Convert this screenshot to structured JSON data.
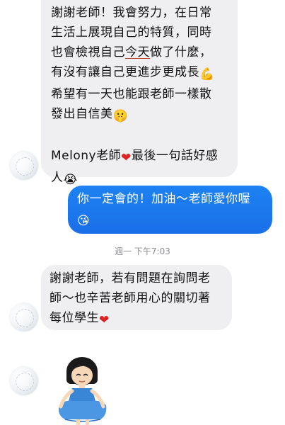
{
  "thread": {
    "bubble_1": {
      "lines": [
        "謝謝老師！我會努力，在日常",
        "生活上展現自己的特質，同時",
        "也會檢視自己",
        "今天",
        "做了什麼，",
        "有沒有讓自己更進步更成長",
        "希望有一天也能跟老師一樣散",
        "發出自信美",
        "Melony老師",
        "最後一句話好感",
        "人"
      ],
      "emojis": {
        "muscle": "💪",
        "shush": "🤫",
        "heart": "❤",
        "cry": "😭"
      }
    },
    "bubble_2": {
      "line_1": "你一定會的！加油～老師愛你喔",
      "emoji": "😘"
    },
    "timestamp": "週一 下午7:03",
    "bubble_3": {
      "lines": [
        "謝謝老師，若有問題在詢問老",
        "師～也辛苦老師用心的關切著",
        "每位學生"
      ],
      "heart": "❤"
    }
  }
}
